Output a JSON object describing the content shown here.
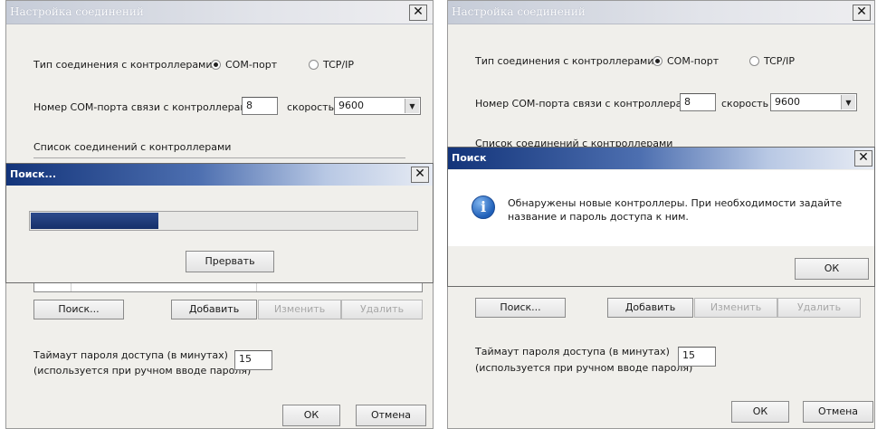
{
  "left": {
    "window_title": "Настройка соединений",
    "close_glyph": "✕",
    "conn_type_label": "Тип соединения с контроллерами",
    "radio_com": "COM-порт",
    "radio_tcp": "TCP/IP",
    "com_port_label": "Номер COM-порта связи с контроллерами",
    "com_port_value": "8",
    "speed_label": "скорость",
    "speed_value": "9600",
    "list_label": "Список соединений с контроллерами",
    "search_dialog": {
      "title": "Поиск...",
      "close_glyph": "✕",
      "progress": 0.33,
      "abort_button": "Прервать"
    },
    "search_button": "Поиск...",
    "add_button": "Добавить",
    "edit_button": "Изменить",
    "delete_button": "Удалить",
    "timeout_label_1": "Таймаут пароля доступа (в минутах)",
    "timeout_label_2": "(используется при ручном вводе пароля)",
    "timeout_value": "15",
    "ok_button": "ОК",
    "cancel_button": "Отмена"
  },
  "right": {
    "window_title": "Настройка соединений",
    "close_glyph": "✕",
    "conn_type_label": "Тип соединения с контроллерами",
    "radio_com": "COM-порт",
    "radio_tcp": "TCP/IP",
    "com_port_label": "Номер COM-порта связи с контроллерами",
    "com_port_value": "8",
    "speed_label": "скорость",
    "speed_value": "9600",
    "list_label": "Список соединений с контроллерами",
    "message_dialog": {
      "title": "Поиск",
      "close_glyph": "✕",
      "icon": "info-icon",
      "message_line_1": "Обнаружены новые контроллеры. При необходимости задайте",
      "message_line_2": "название и пароль доступа к ним.",
      "ok_button": "ОК"
    },
    "search_button": "Поиск...",
    "add_button": "Добавить",
    "edit_button": "Изменить",
    "delete_button": "Удалить",
    "timeout_label_1": "Таймаут пароля доступа (в минутах)",
    "timeout_label_2": "(используется при ручном вводе пароля)",
    "timeout_value": "15",
    "ok_button": "ОК",
    "cancel_button": "Отмена"
  }
}
